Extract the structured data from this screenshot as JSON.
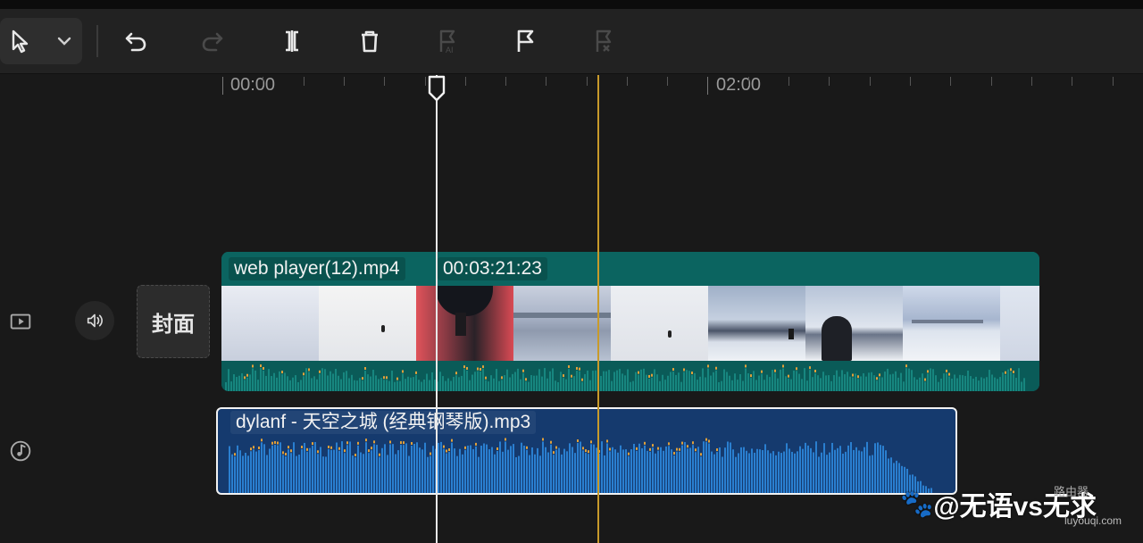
{
  "toolbar": {
    "tools": [
      {
        "name": "select-tool",
        "icon": "cursor-arrow-icon",
        "enabled": true
      },
      {
        "name": "select-dropdown",
        "icon": "chevron-down-icon",
        "enabled": true
      },
      {
        "name": "undo",
        "icon": "undo-icon",
        "enabled": true
      },
      {
        "name": "redo",
        "icon": "redo-icon",
        "enabled": false
      },
      {
        "name": "split",
        "icon": "split-icon",
        "enabled": true
      },
      {
        "name": "delete",
        "icon": "trash-icon",
        "enabled": true
      },
      {
        "name": "ai-marker",
        "icon": "flag-ai-icon",
        "enabled": false
      },
      {
        "name": "add-marker",
        "icon": "flag-icon",
        "enabled": true
      },
      {
        "name": "remove-marker",
        "icon": "flag-remove-icon",
        "enabled": false
      }
    ]
  },
  "ruler": {
    "labels": [
      "00:00",
      "02:00"
    ]
  },
  "tracks": {
    "video": {
      "cover_label": "封面",
      "clip_name": "web player(12).mp4",
      "clip_duration": "00:03:21:23"
    },
    "audio": {
      "clip_name": "dylanf - 天空之城 (经典钢琴版).mp3"
    }
  },
  "watermark": {
    "text": "@无语vs无求",
    "sub": "路由器",
    "url": "luyouqi.com"
  },
  "colors": {
    "video_clip": "#0e6a66",
    "audio_clip": "#153a6e",
    "playhead": "#e8e8e8",
    "marker": "#c89a2a"
  }
}
